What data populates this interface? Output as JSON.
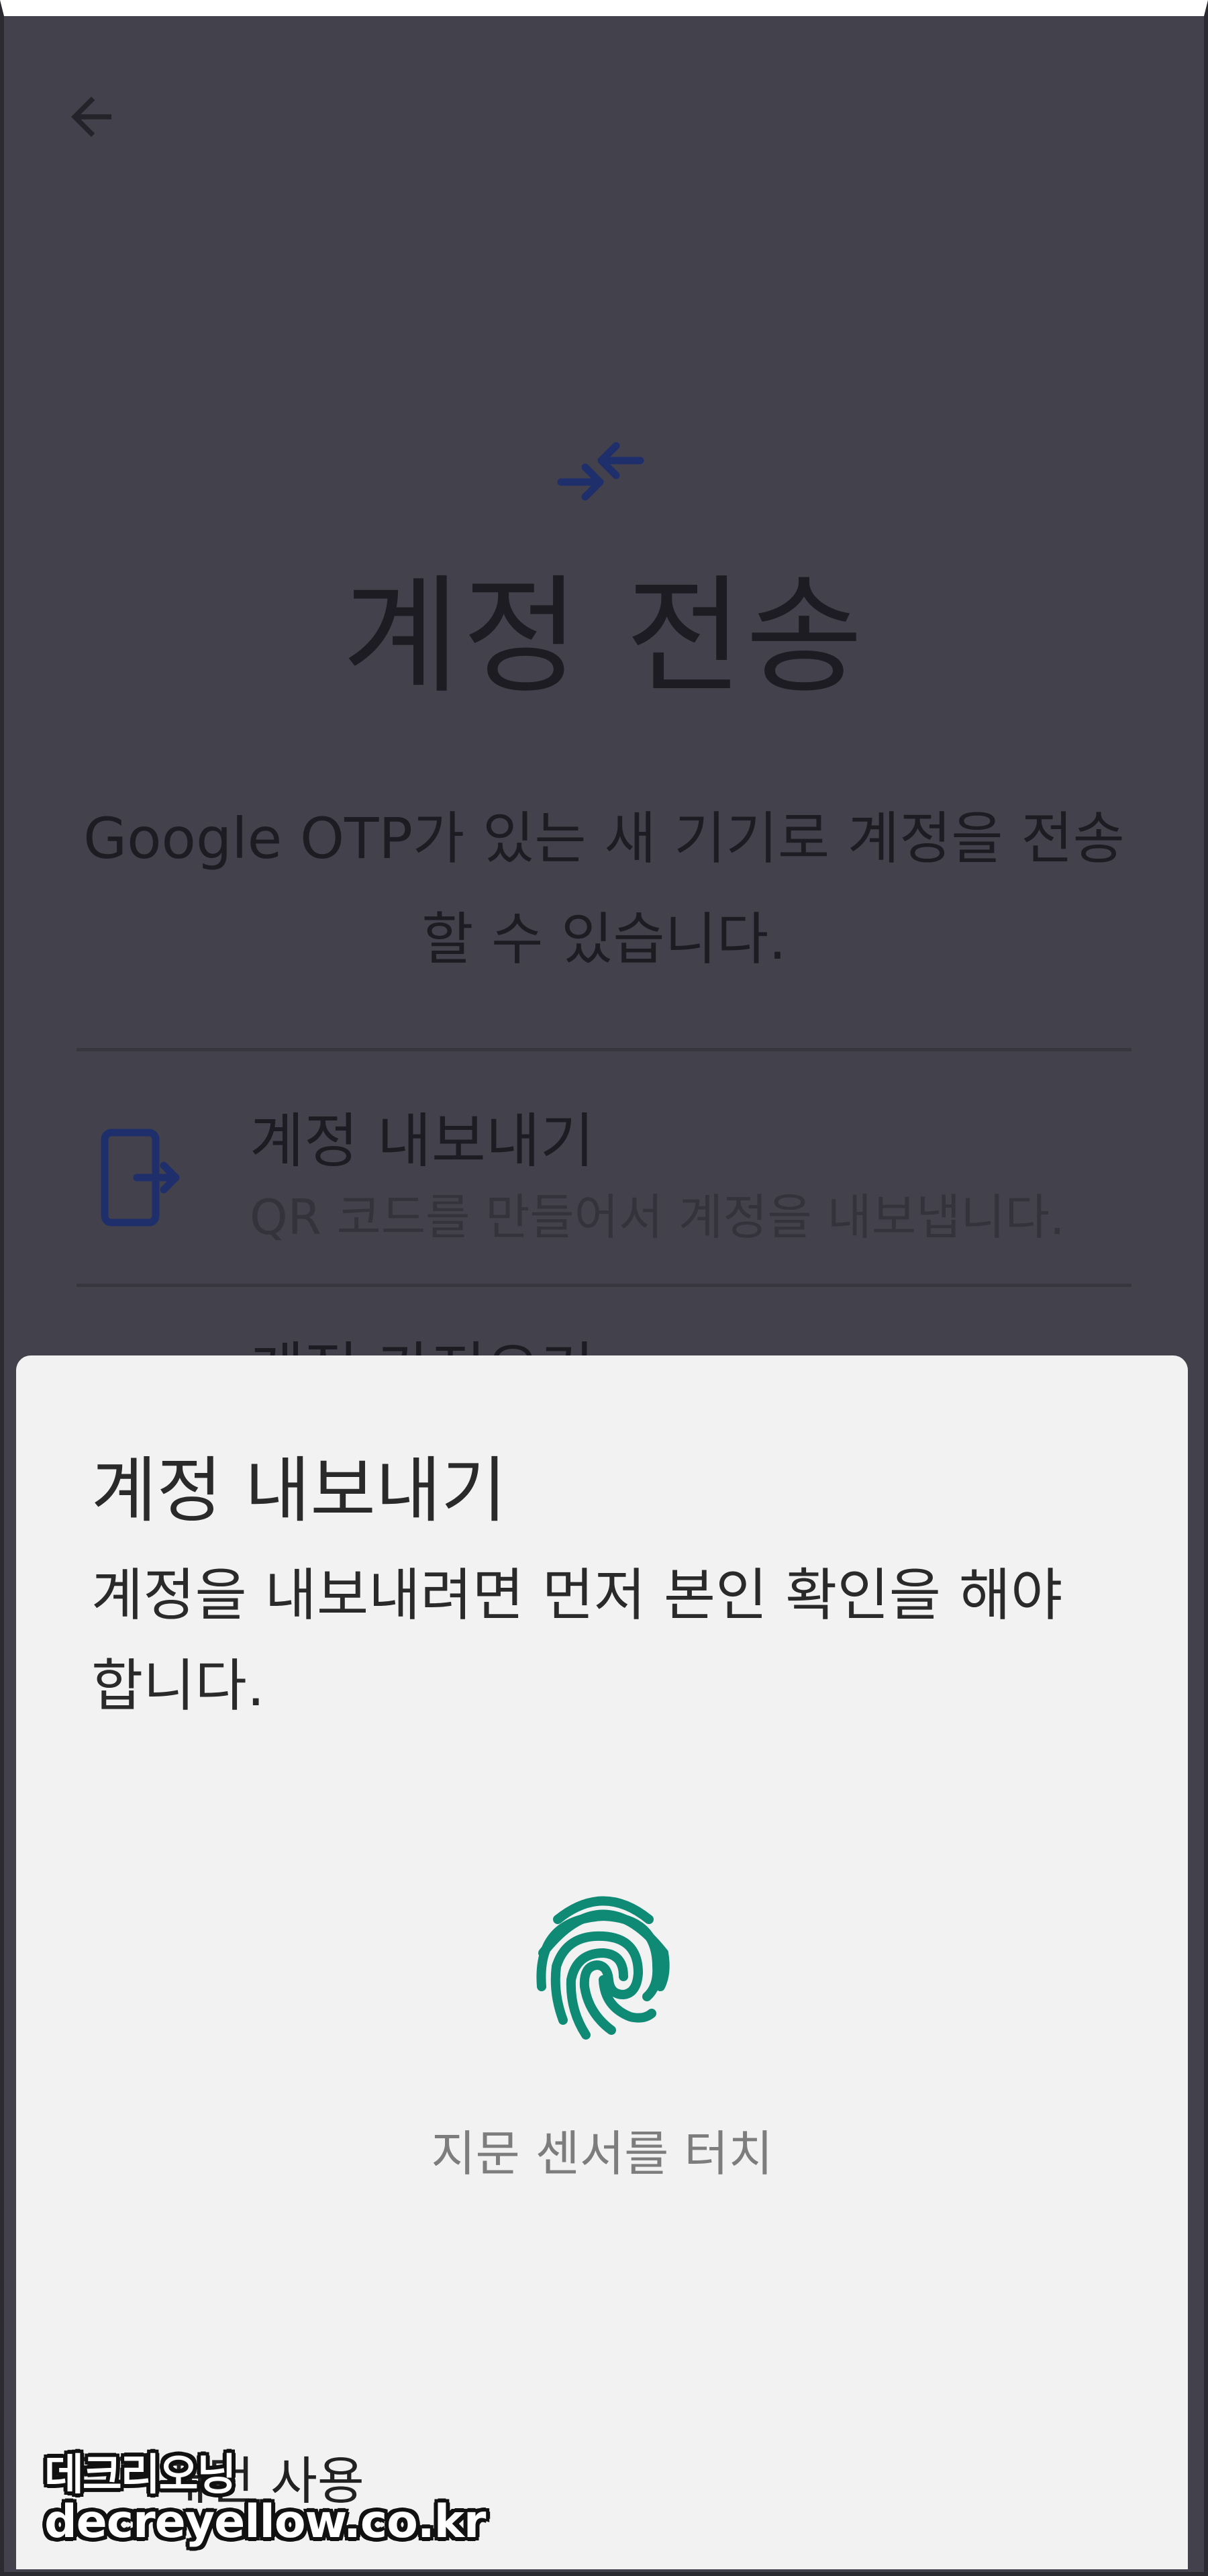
{
  "screen": {
    "title": "계정 전송",
    "description": "Google OTP가 있는 새 기기로 계정을 전송할 수 있습니다.",
    "back_icon": "arrow-left-icon",
    "transfer_icon": "transfer-arrows-icon"
  },
  "options": [
    {
      "title": "계정 내보내기",
      "subtitle": "QR 코드를 만들어서 계정을 내보냅니다.",
      "icon": "export-phone-icon"
    },
    {
      "title": "계정 가져오기"
    }
  ],
  "dialog": {
    "title": "계정 내보내기",
    "message": "계정을 내보내려면 먼저 본인 확인을 해야 합니다.",
    "fingerprint_icon": "fingerprint-icon",
    "fingerprint_hint": "지문 센서를 터치",
    "pattern_button": "패턴 사용"
  },
  "watermark": {
    "line1": "데크리오닝",
    "line2": "decreyellow.co.kr"
  },
  "colors": {
    "accent": "#0f8a75",
    "scrim": "#43414b",
    "icon_navy": "#1f2f6c",
    "sheet_bg": "#f2f2f2"
  }
}
